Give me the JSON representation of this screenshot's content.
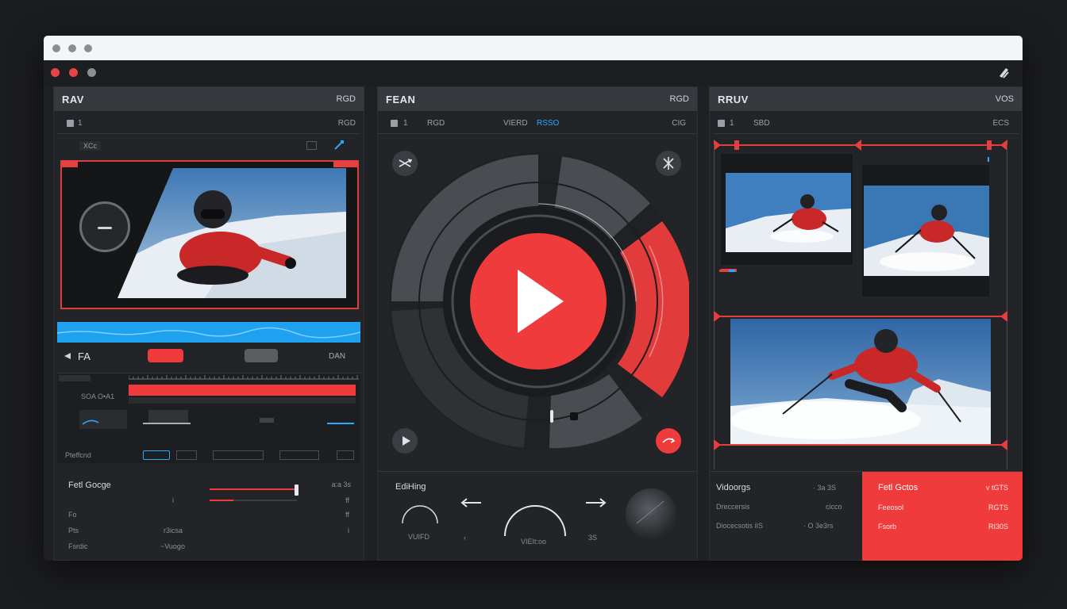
{
  "colors": {
    "accent": "#ef3b3b",
    "panel": "#232427",
    "header": "#36393e",
    "blue": "#2aa8ff"
  },
  "left": {
    "title": "RAV",
    "title_right": "RGD",
    "sub_a": "1",
    "sub_b": "RGD",
    "sub_c": "XCc",
    "transport_label": "FA",
    "transport_right": "DAN",
    "track_label_1": "SOA O•A1",
    "track_label_2": "Pteffcnd",
    "props": {
      "title": "Fetl Gocge",
      "rows": [
        {
          "label": "Fo",
          "v1": "i",
          "v2": ""
        },
        {
          "label": "Pts",
          "v1": "r3icsa",
          "v2": "i"
        },
        {
          "label": "Fsrdic",
          "v1": "~Vuogo",
          "v2": ""
        }
      ],
      "right_top": "a:a 3s",
      "right_mid": "ff",
      "right_low": "ff"
    }
  },
  "center": {
    "title": "FEAN",
    "title_right": "RGD",
    "sub_a": "1",
    "sub_b": "RGD",
    "sub_c": "VIERD",
    "sub_d": "RSSO",
    "sub_e": "CIG",
    "bottom": {
      "title": "EdiHing",
      "left_label": "VUIFD",
      "center_label": "VIEIt:oo",
      "page_a": "‹",
      "page_b": "3S"
    }
  },
  "right": {
    "title": "RRUV",
    "title_right": "VOS",
    "sub_a": "1",
    "sub_b": "SBD",
    "sub_c": "ECS",
    "stats": {
      "title": "Vidoorgs",
      "title_val": "· 3a 3S",
      "rows": [
        {
          "label": "Dreccersis",
          "val": "cicco"
        },
        {
          "label": "Diocecsotis iIS",
          "val": "· O 3e3rs"
        }
      ]
    },
    "highlight": {
      "title": "Fetl Gctos",
      "title_val": "v tGTS",
      "rows": [
        {
          "label": "Feeosol",
          "val": "RGTS"
        },
        {
          "label": "Fsorb",
          "val": "RI30S"
        }
      ]
    }
  }
}
